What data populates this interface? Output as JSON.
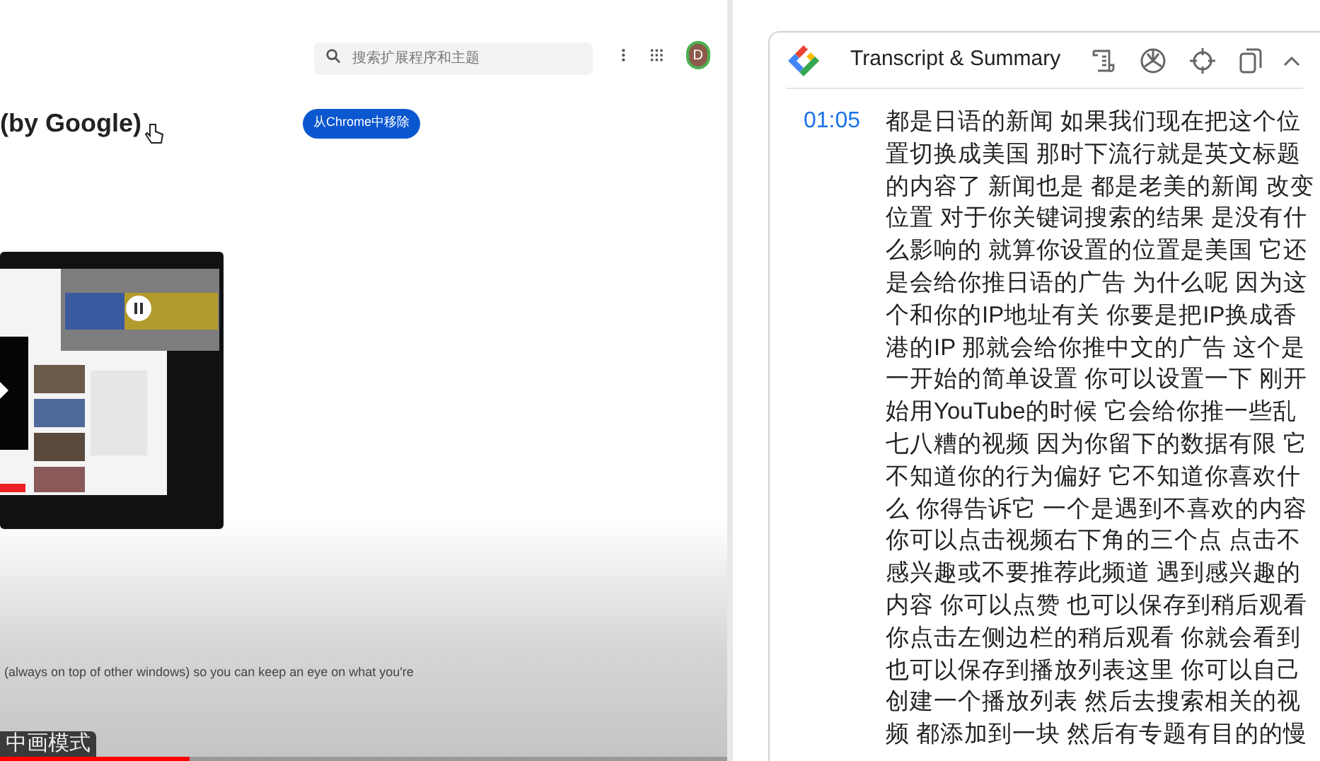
{
  "video": {
    "store_page": {
      "search": {
        "placeholder": "搜索扩展程序和主题"
      },
      "avatar_letter": "D",
      "title": "(by Google)",
      "remove_button": "从Chrome中移除",
      "description": "(always on top of other windows) so you can keep an eye on what you're"
    },
    "subtitle": "中画模式",
    "progress": {
      "level": 0.26
    }
  },
  "transcript_panel": {
    "title": "Transcript & Summary",
    "entries": [
      {
        "time": "01:05",
        "lines": [
          "都是日语的新闻 如果我们现在把这个位",
          "置切换成美国 那时下流行就是英文标题",
          "的内容了 新闻也是 都是老美的新闻 改变",
          "位置 对于你关键词搜索的结果 是没有什",
          "么影响的 就算你设置的位置是美国 它还",
          "是会给你推日语的广告 为什么呢 因为这",
          "个和你的IP地址有关 你要是把IP换成香",
          "港的IP 那就会给你推中文的广告 这个是",
          "一开始的简单设置 你可以设置一下 刚开",
          "始用YouTube的时候 它会给你推一些乱",
          "七八糟的视频 因为你留下的数据有限 它",
          "不知道你的行为偏好 它不知道你喜欢什",
          "么 你得告诉它 一个是遇到不喜欢的内容",
          "你可以点击视频右下角的三个点 点击不",
          "感兴趣或不要推荐此频道 遇到感兴趣的",
          "内容 你可以点赞 也可以保存到稍后观看",
          "你点击左侧边栏的稍后观看 你就会看到",
          "也可以保存到播放列表这里 你可以自己",
          "创建一个播放列表 然后去搜索相关的视",
          "频 都添加到一块 然后有专题有目的的慢"
        ]
      }
    ]
  }
}
